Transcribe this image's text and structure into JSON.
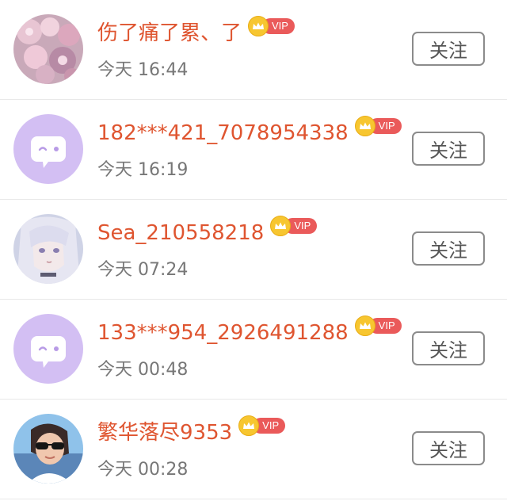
{
  "theme": {
    "name_color": "#df5530",
    "vip_tag_color": "#ea5a5a",
    "time_color": "#777777",
    "placeholder_avatar_bg": "#d3bff3"
  },
  "list": {
    "items": [
      {
        "name": "伤了痛了累、了",
        "vip": "VIP",
        "time": "今天 16:44",
        "follow_label": "关注",
        "avatar": "pink-flowers-photo"
      },
      {
        "name": "182***421_7078954338",
        "vip": "VIP",
        "time": "今天 16:19",
        "follow_label": "关注",
        "avatar": "default-chat-bubble-icon"
      },
      {
        "name": "Sea_210558218",
        "vip": "VIP",
        "time": "今天 07:24",
        "follow_label": "关注",
        "avatar": "anime-girl-portrait"
      },
      {
        "name": "133***954_2926491288",
        "vip": "VIP",
        "time": "今天 00:48",
        "follow_label": "关注",
        "avatar": "default-chat-bubble-icon"
      },
      {
        "name": "繁华落尽9353",
        "vip": "VIP",
        "time": "今天 00:28",
        "follow_label": "关注",
        "avatar": "person-with-sunglasses-photo"
      }
    ]
  }
}
